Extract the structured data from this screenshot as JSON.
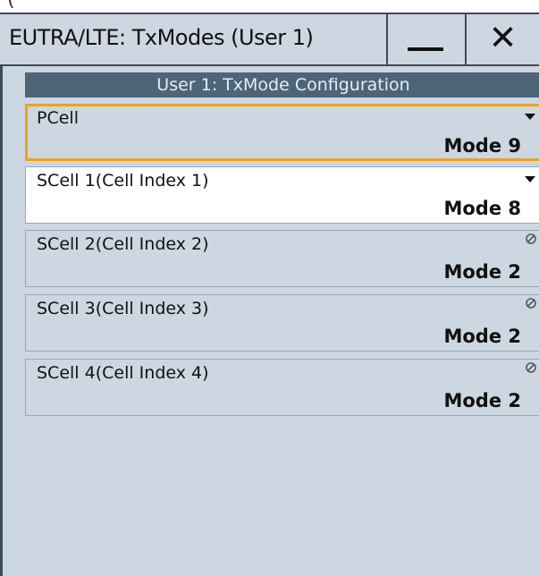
{
  "dialog": {
    "title": "EUTRA/LTE: TxModes (User 1)",
    "minimize_icon": "minimize-icon",
    "close_icon": "close-icon",
    "close_glyph": "✕"
  },
  "panel": {
    "header": "User 1: TxMode Configuration",
    "fields": [
      {
        "label": "PCell",
        "value": "Mode 9",
        "state": "focused",
        "icon": "dropdown-arrow-icon"
      },
      {
        "label": "SCell 1(Cell Index 1)",
        "value": "Mode 8",
        "state": "enabled",
        "icon": "dropdown-arrow-icon"
      },
      {
        "label": "SCell 2(Cell Index 2)",
        "value": "Mode 2",
        "state": "disabled",
        "icon": "disabled-icon"
      },
      {
        "label": "SCell 3(Cell Index 3)",
        "value": "Mode 2",
        "state": "disabled",
        "icon": "disabled-icon"
      },
      {
        "label": "SCell 4(Cell Index 4)",
        "value": "Mode 2",
        "state": "disabled",
        "icon": "disabled-icon"
      }
    ]
  },
  "colors": {
    "dialog_background": "#cdd7e1",
    "header_background": "#4e6477",
    "focus_border": "#f0a020",
    "frame": "#3d4b5b"
  }
}
